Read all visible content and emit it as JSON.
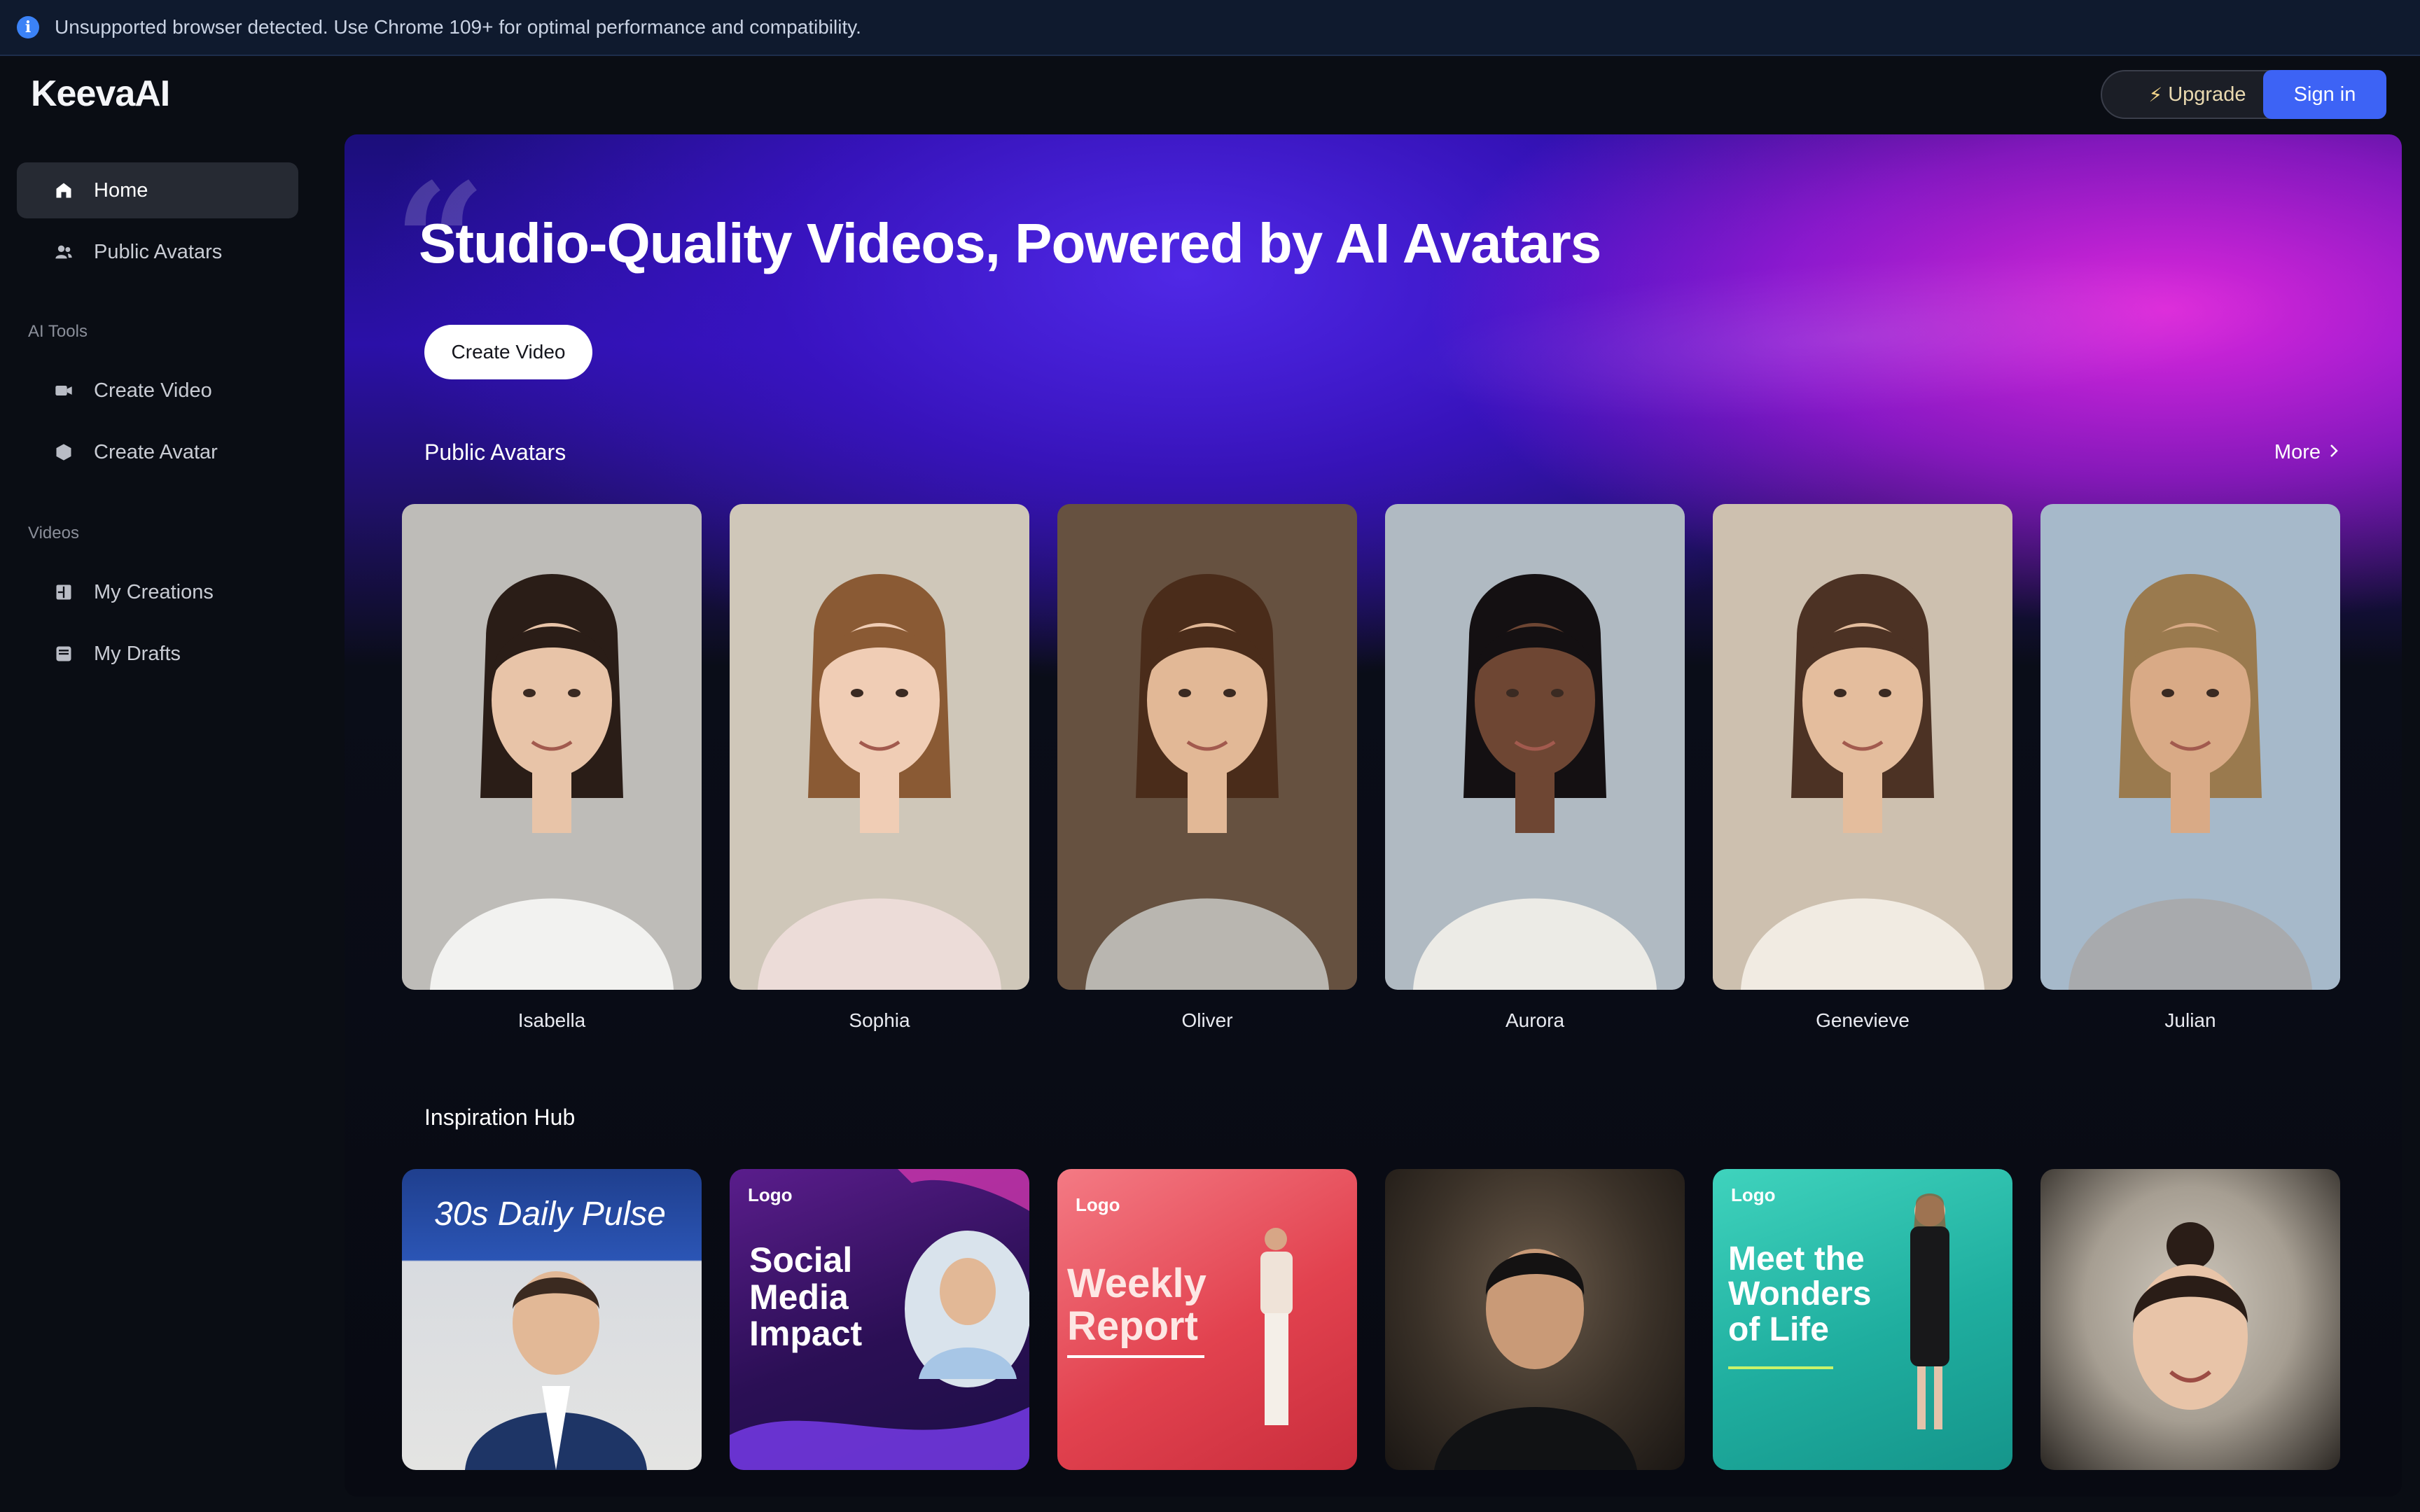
{
  "banner": {
    "text": "Unsupported browser detected. Use Chrome 109+ for optimal performance and compatibility."
  },
  "header": {
    "logo": "KeevaAI",
    "upgrade_label": "Upgrade",
    "signin_label": "Sign in"
  },
  "sidebar": {
    "items": [
      {
        "label": "Home",
        "icon": "home-icon",
        "active": true
      },
      {
        "label": "Public Avatars",
        "icon": "users-icon"
      }
    ],
    "ai_tools_label": "AI Tools",
    "ai_tools": [
      {
        "label": "Create Video",
        "icon": "video-camera-icon"
      },
      {
        "label": "Create Avatar",
        "icon": "avatar-blob-icon"
      }
    ],
    "videos_label": "Videos",
    "videos": [
      {
        "label": "My Creations",
        "icon": "creations-icon"
      },
      {
        "label": "My Drafts",
        "icon": "drafts-icon"
      }
    ]
  },
  "hero": {
    "title": "Studio-Quality Videos, Powered by AI Avatars",
    "cta_label": "Create Video"
  },
  "public_avatars": {
    "title": "Public Avatars",
    "more_label": "More",
    "avatars": [
      {
        "name": "Isabella",
        "bg": "#b9b7b2",
        "skin": "#e8c4a8",
        "hair": "#2a1d17",
        "top": "#f2f2f0"
      },
      {
        "name": "Sophia",
        "bg": "#cbc3b4",
        "skin": "#f0cdb5",
        "hair": "#8a5a34",
        "top": "#ecdcd8"
      },
      {
        "name": "Oliver",
        "bg": "#5a4330",
        "skin": "#e2b896",
        "hair": "#4a2c1a",
        "top": "#b9b6b0"
      },
      {
        "name": "Aurora",
        "bg": "#aab5bd",
        "skin": "#6e4633",
        "hair": "#141012",
        "top": "#ecebe6"
      },
      {
        "name": "Genevieve",
        "bg": "#c9bba9",
        "skin": "#e4bd9d",
        "hair": "#4c3224",
        "top": "#f1ebe2"
      },
      {
        "name": "Julian",
        "bg": "#9fb3c6",
        "skin": "#d9aa86",
        "hair": "#9a7a4e",
        "top": "#a8aaad"
      }
    ]
  },
  "inspiration": {
    "title": "Inspiration Hub",
    "cards": [
      {
        "kind": "pulse",
        "title": "30s Daily Pulse"
      },
      {
        "kind": "social",
        "logo": "Logo",
        "title": "Social Media Impact"
      },
      {
        "kind": "weekly",
        "logo": "Logo",
        "title": "Weekly Report"
      },
      {
        "kind": "portrait"
      },
      {
        "kind": "wonders",
        "logo": "Logo",
        "title": "Meet the Wonders of Life"
      },
      {
        "kind": "portrait2"
      }
    ]
  }
}
